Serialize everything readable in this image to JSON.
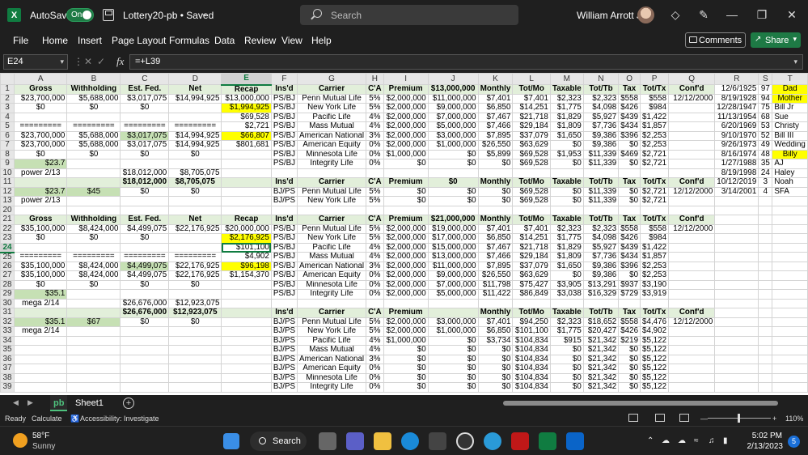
{
  "titlebar": {
    "autosave_label": "AutoSave",
    "autosave_state": "On",
    "doc_title": "Lottery20-pb • Saved",
    "search_placeholder": "Search",
    "user_name": "William Arrott Jr"
  },
  "menu": [
    "File",
    "Home",
    "Insert",
    "Page Layout",
    "Formulas",
    "Data",
    "Review",
    "View",
    "Help"
  ],
  "buttons": {
    "comments": "Comments",
    "share": "Share"
  },
  "formula_bar": {
    "name_box": "E24",
    "formula": "=+L39"
  },
  "columns": [
    "A",
    "B",
    "C",
    "D",
    "E",
    "F",
    "G",
    "H",
    "I",
    "J",
    "K",
    "L",
    "M",
    "N",
    "O",
    "P",
    "Q",
    "R",
    "S",
    "T"
  ],
  "rows": [
    {
      "n": "1",
      "cells": [
        "Gross",
        "Withholding",
        "Est. Fed.",
        "Net",
        "Recap",
        "Ins'd",
        "Carrier",
        "C'A",
        "Premium",
        "$13,000,000",
        "Monthly",
        "Tot/Mo",
        "Taxable",
        "Tot/Tb",
        "Tax",
        "Tot/Tx",
        "Conf'd",
        "12/6/1925",
        "97",
        "Dad"
      ]
    },
    {
      "n": "2",
      "cells": [
        "$23,700,000",
        "$5,688,000",
        "$3,017,075",
        "$14,994,925",
        "$13,000,000",
        "PS/BJ",
        "Penn Mutual Life",
        "5%",
        "$2,000,000",
        "$11,000,000",
        "$7,401",
        "$7,401",
        "$2,323",
        "$2,323",
        "$558",
        "$558",
        "12/12/2000",
        "8/19/1928",
        "94",
        "Mother"
      ]
    },
    {
      "n": "3",
      "cells": [
        "$0",
        "$0",
        "$0",
        "",
        "$1,994,925",
        "PS/BJ",
        "New York Life",
        "5%",
        "$2,000,000",
        "$9,000,000",
        "$6,850",
        "$14,251",
        "$1,775",
        "$4,098",
        "$426",
        "$984",
        "",
        "12/28/1947",
        "75",
        "Bill Jr"
      ]
    },
    {
      "n": "4",
      "cells": [
        "",
        "",
        "",
        "",
        "$69,528",
        "PS/BJ",
        "Pacific Life",
        "4%",
        "$2,000,000",
        "$7,000,000",
        "$7,467",
        "$21,718",
        "$1,829",
        "$5,927",
        "$439",
        "$1,422",
        "",
        "11/13/1954",
        "68",
        "Sue"
      ]
    },
    {
      "n": "5",
      "cells": [
        "=========",
        "=========",
        "=========",
        "=========",
        "$2,721",
        "PS/BJ",
        "Mass Mutual",
        "4%",
        "$2,000,000",
        "$5,000,000",
        "$7,466",
        "$29,184",
        "$1,809",
        "$7,736",
        "$434",
        "$1,857",
        "",
        "6/20/1969",
        "53",
        "Christy"
      ]
    },
    {
      "n": "6",
      "cells": [
        "$23,700,000",
        "$5,688,000",
        "$3,017,075",
        "$14,994,925",
        "$66,807",
        "PS/BJ",
        "American National",
        "3%",
        "$2,000,000",
        "$3,000,000",
        "$7,895",
        "$37,079",
        "$1,650",
        "$9,386",
        "$396",
        "$2,253",
        "",
        "9/10/1970",
        "52",
        "Bill III"
      ]
    },
    {
      "n": "7",
      "cells": [
        "$23,700,000",
        "$5,688,000",
        "$3,017,075",
        "$14,994,925",
        "$801,681",
        "PS/BJ",
        "American Equity",
        "0%",
        "$2,000,000",
        "$1,000,000",
        "$26,550",
        "$63,629",
        "$0",
        "$9,386",
        "$0",
        "$2,253",
        "",
        "9/26/1973",
        "49",
        "Wedding"
      ]
    },
    {
      "n": "8",
      "cells": [
        "$0",
        "$0",
        "$0",
        "$0",
        "",
        "PS/BJ",
        "Minnesota Life",
        "0%",
        "$1,000,000",
        "$0",
        "$5,899",
        "$69,528",
        "$1,953",
        "$11,339",
        "$469",
        "$2,721",
        "",
        "8/16/1974",
        "48",
        "Billy"
      ]
    },
    {
      "n": "9",
      "cells": [
        "$23.7",
        "",
        "",
        "",
        "",
        "PS/BJ",
        "Integrity Life",
        "0%",
        "$0",
        "$0",
        "$0",
        "$69,528",
        "$0",
        "$11,339",
        "$0",
        "$2,721",
        "",
        "1/27/1988",
        "35",
        "AJ"
      ]
    },
    {
      "n": "10",
      "cells": [
        "power 2/13",
        "",
        "$18,012,000",
        "$8,705,075",
        "",
        "",
        "",
        "",
        "",
        "",
        "",
        "",
        "",
        "",
        "",
        "",
        "",
        "8/19/1998",
        "24",
        "Haley"
      ]
    },
    {
      "n": "11",
      "cells": [
        "",
        "",
        "$18,012,000",
        "$8,705,075",
        "",
        "Ins'd",
        "Carrier",
        "C'A",
        "Premium",
        "$0",
        "Monthly",
        "Tot/Mo",
        "Taxable",
        "Tot/Tb",
        "Tax",
        "Tot/Tx",
        "Conf'd",
        "10/12/2019",
        "3",
        "Noah"
      ]
    },
    {
      "n": "12",
      "cells": [
        "$23.7",
        "$45",
        "$0",
        "$0",
        "",
        "BJ/PS",
        "Penn Mutual Life",
        "5%",
        "$0",
        "$0",
        "$0",
        "$69,528",
        "$0",
        "$11,339",
        "$0",
        "$2,721",
        "12/12/2000",
        "3/14/2001",
        "4",
        "SFA"
      ]
    },
    {
      "n": "13",
      "cells": [
        "power 2/13",
        "",
        "",
        "",
        "",
        "BJ/PS",
        "New York Life",
        "5%",
        "$0",
        "$0",
        "$0",
        "$69,528",
        "$0",
        "$11,339",
        "$0",
        "$2,721",
        "",
        "",
        "",
        ""
      ]
    },
    {
      "n": "20",
      "cells": [
        "",
        "",
        "",
        "",
        "",
        "",
        "",
        "",
        "",
        "",
        "",
        "",
        "",
        "",
        "",
        "",
        "",
        "",
        "",
        ""
      ]
    },
    {
      "n": "21",
      "cells": [
        "Gross",
        "Withholding",
        "Est. Fed.",
        "Net",
        "Recap",
        "Ins'd",
        "Carrier",
        "C'A",
        "Premium",
        "$21,000,000",
        "Monthly",
        "Tot/Mo",
        "Taxable",
        "Tot/Tb",
        "Tax",
        "Tot/Tx",
        "Conf'd",
        "",
        "",
        ""
      ]
    },
    {
      "n": "22",
      "cells": [
        "$35,100,000",
        "$8,424,000",
        "$4,499,075",
        "$22,176,925",
        "$20,000,000",
        "PS/BJ",
        "Penn Mutual Life",
        "5%",
        "$2,000,000",
        "$19,000,000",
        "$7,401",
        "$7,401",
        "$2,323",
        "$2,323",
        "$558",
        "$558",
        "12/12/2000",
        "",
        "",
        ""
      ]
    },
    {
      "n": "23",
      "cells": [
        "$0",
        "$0",
        "$0",
        "",
        "$2,176,925",
        "PS/BJ",
        "New York Life",
        "5%",
        "$2,000,000",
        "$17,000,000",
        "$6,850",
        "$14,251",
        "$1,775",
        "$4,098",
        "$426",
        "$984",
        "",
        "",
        "",
        ""
      ]
    },
    {
      "n": "24",
      "cells": [
        "",
        "",
        "",
        "",
        "$101,100",
        "PS/BJ",
        "Pacific Life",
        "4%",
        "$2,000,000",
        "$15,000,000",
        "$7,467",
        "$21,718",
        "$1,829",
        "$5,927",
        "$439",
        "$1,422",
        "",
        "",
        "",
        ""
      ]
    },
    {
      "n": "25",
      "cells": [
        "=========",
        "=========",
        "=========",
        "=========",
        "$4,902",
        "PS/BJ",
        "Mass Mutual",
        "4%",
        "$2,000,000",
        "$13,000,000",
        "$7,466",
        "$29,184",
        "$1,809",
        "$7,736",
        "$434",
        "$1,857",
        "",
        "",
        "",
        ""
      ]
    },
    {
      "n": "26",
      "cells": [
        "$35,100,000",
        "$8,424,000",
        "$4,499,075",
        "$22,176,925",
        "$96,198",
        "PS/BJ",
        "American National",
        "3%",
        "$2,000,000",
        "$11,000,000",
        "$7,895",
        "$37,079",
        "$1,650",
        "$9,386",
        "$396",
        "$2,253",
        "",
        "",
        "",
        ""
      ]
    },
    {
      "n": "27",
      "cells": [
        "$35,100,000",
        "$8,424,000",
        "$4,499,075",
        "$22,176,925",
        "$1,154,370",
        "PS/BJ",
        "American Equity",
        "0%",
        "$2,000,000",
        "$9,000,000",
        "$26,550",
        "$63,629",
        "$0",
        "$9,386",
        "$0",
        "$2,253",
        "",
        "",
        "",
        ""
      ]
    },
    {
      "n": "28",
      "cells": [
        "$0",
        "$0",
        "$0",
        "$0",
        "",
        "PS/BJ",
        "Minnesota Life",
        "0%",
        "$2,000,000",
        "$7,000,000",
        "$11,798",
        "$75,427",
        "$3,905",
        "$13,291",
        "$937",
        "$3,190",
        "",
        "",
        "",
        ""
      ]
    },
    {
      "n": "29",
      "cells": [
        "$35.1",
        "",
        "",
        "",
        "",
        "PS/BJ",
        "Integrity Life",
        "0%",
        "$2,000,000",
        "$5,000,000",
        "$11,422",
        "$86,849",
        "$3,038",
        "$16,329",
        "$729",
        "$3,919",
        "",
        "",
        "",
        ""
      ]
    },
    {
      "n": "30",
      "cells": [
        "mega 2/14",
        "",
        "$26,676,000",
        "$12,923,075",
        "",
        "",
        "",
        "",
        "",
        "",
        "",
        "",
        "",
        "",
        "",
        "",
        "",
        "",
        "",
        ""
      ]
    },
    {
      "n": "31",
      "cells": [
        "",
        "",
        "$26,676,000",
        "$12,923,075",
        "",
        "Ins'd",
        "Carrier",
        "C'A",
        "Premium",
        "",
        "Monthly",
        "Tot/Mo",
        "Taxable",
        "Tot/Tb",
        "Tax",
        "Tot/Tx",
        "Conf'd",
        "",
        "",
        ""
      ]
    },
    {
      "n": "32",
      "cells": [
        "$35.1",
        "$67",
        "$0",
        "$0",
        "",
        "BJ/PS",
        "Penn Mutual Life",
        "5%",
        "$2,000,000",
        "$3,000,000",
        "$7,401",
        "$94,250",
        "$2,323",
        "$18,652",
        "$558",
        "$4,476",
        "12/12/2000",
        "",
        "",
        ""
      ]
    },
    {
      "n": "33",
      "cells": [
        "mega 2/14",
        "",
        "",
        "",
        "",
        "BJ/PS",
        "New York Life",
        "5%",
        "$2,000,000",
        "$1,000,000",
        "$6,850",
        "$101,100",
        "$1,775",
        "$20,427",
        "$426",
        "$4,902",
        "",
        "",
        "",
        ""
      ]
    },
    {
      "n": "34",
      "cells": [
        "",
        "",
        "",
        "",
        "",
        "BJ/PS",
        "Pacific Life",
        "4%",
        "$1,000,000",
        "$0",
        "$3,734",
        "$104,834",
        "$915",
        "$21,342",
        "$219",
        "$5,122",
        "",
        "",
        "",
        ""
      ]
    },
    {
      "n": "35",
      "cells": [
        "",
        "",
        "",
        "",
        "",
        "BJ/PS",
        "Mass Mutual",
        "4%",
        "$0",
        "$0",
        "$0",
        "$104,834",
        "$0",
        "$21,342",
        "$0",
        "$5,122",
        "",
        "",
        "",
        ""
      ]
    },
    {
      "n": "36",
      "cells": [
        "",
        "",
        "",
        "",
        "",
        "BJ/PS",
        "American National",
        "3%",
        "$0",
        "$0",
        "$0",
        "$104,834",
        "$0",
        "$21,342",
        "$0",
        "$5,122",
        "",
        "",
        "",
        ""
      ]
    },
    {
      "n": "37",
      "cells": [
        "",
        "",
        "",
        "",
        "",
        "BJ/PS",
        "American Equity",
        "0%",
        "$0",
        "$0",
        "$0",
        "$104,834",
        "$0",
        "$21,342",
        "$0",
        "$5,122",
        "",
        "",
        "",
        ""
      ]
    },
    {
      "n": "38",
      "cells": [
        "",
        "",
        "",
        "",
        "",
        "BJ/PS",
        "Minnesota Life",
        "0%",
        "$0",
        "$0",
        "$0",
        "$104,834",
        "$0",
        "$21,342",
        "$0",
        "$5,122",
        "",
        "",
        "",
        ""
      ]
    },
    {
      "n": "39",
      "cells": [
        "",
        "",
        "",
        "",
        "",
        "BJ/PS",
        "Integrity Life",
        "0%",
        "$0",
        "$0",
        "$0",
        "$104,834",
        "$0",
        "$21,342",
        "$0",
        "$5,122",
        "",
        "",
        "",
        ""
      ]
    }
  ],
  "sheets": [
    "pb",
    "Sheet1"
  ],
  "status": {
    "ready": "Ready",
    "calculate": "Calculate",
    "accessibility": "Accessibility: Investigate",
    "zoom": "110%"
  },
  "taskbar": {
    "temp": "58°F",
    "weather": "Sunny",
    "search": "Search",
    "time": "5:02 PM",
    "date": "2/13/2023",
    "notifications": "5"
  },
  "colors": {
    "excel_green": "#107c41",
    "header_green": "#e2efda",
    "highlight_yellow": "#ffff00",
    "share_green": "#1e7a45"
  }
}
